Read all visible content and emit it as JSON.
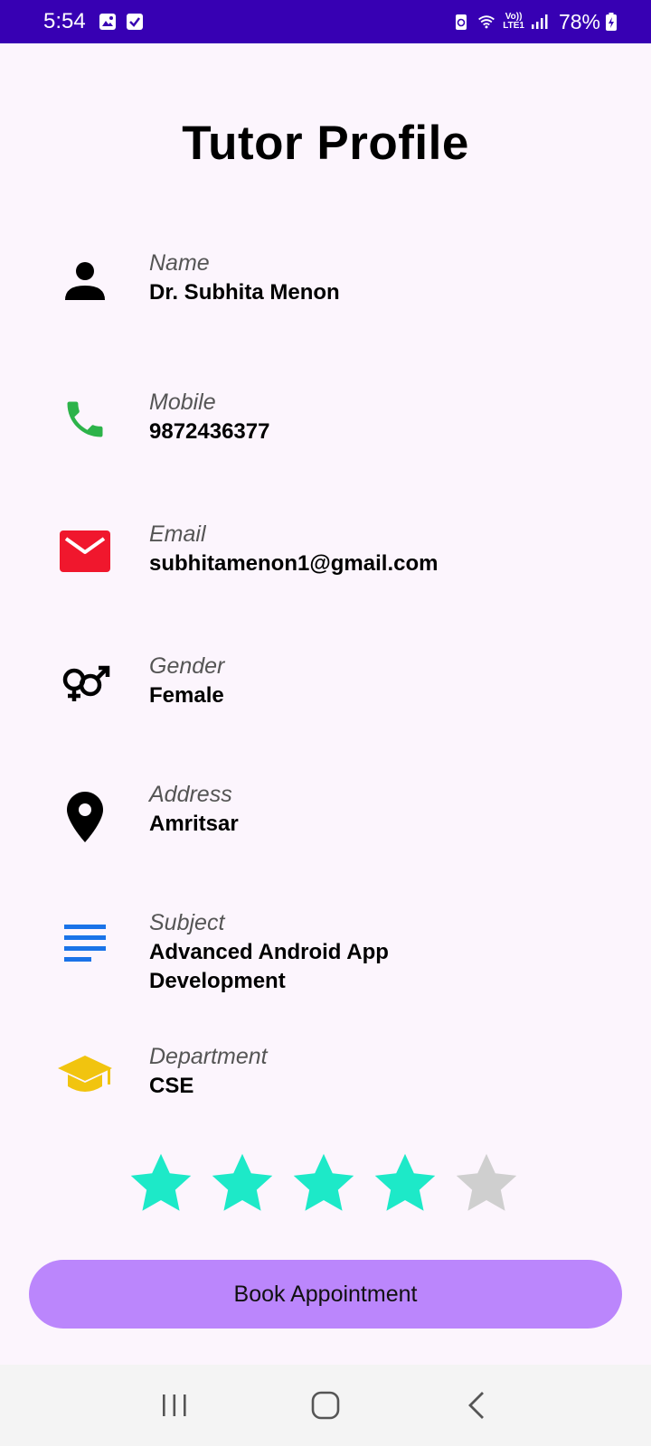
{
  "status_bar": {
    "time": "5:54",
    "network_label_top": "Vo))",
    "network_label_bottom": "LTE1",
    "battery": "78%"
  },
  "title": "Tutor Profile",
  "fields": [
    {
      "label": "Name",
      "value": "Dr. Subhita Menon",
      "icon": "person-icon",
      "icon_color": "#000000"
    },
    {
      "label": "Mobile",
      "value": "9872436377",
      "icon": "phone-icon",
      "icon_color": "#2db34a"
    },
    {
      "label": "Email",
      "value": "subhitamenon1@gmail.com",
      "icon": "mail-icon",
      "icon_color": "#f0172d"
    },
    {
      "label": "Gender",
      "value": "Female",
      "icon": "gender-icon",
      "icon_color": "#000000"
    },
    {
      "label": "Address",
      "value": "Amritsar",
      "icon": "location-pin-icon",
      "icon_color": "#000000"
    },
    {
      "label": "Subject",
      "value": "Advanced Android App Development",
      "icon": "subject-lines-icon",
      "icon_color": "#1a73e8"
    },
    {
      "label": "Department",
      "value": "CSE",
      "icon": "graduation-cap-icon",
      "icon_color": "#f1c40f"
    }
  ],
  "rating": {
    "value": 4,
    "max": 5,
    "filled_color": "#1de9c8",
    "empty_color": "#cfcfcf"
  },
  "book_button": {
    "label": "Book Appointment",
    "color": "#bb86fc"
  },
  "colors": {
    "status_bar": "#3700b3",
    "background": "#fcf5fd"
  }
}
